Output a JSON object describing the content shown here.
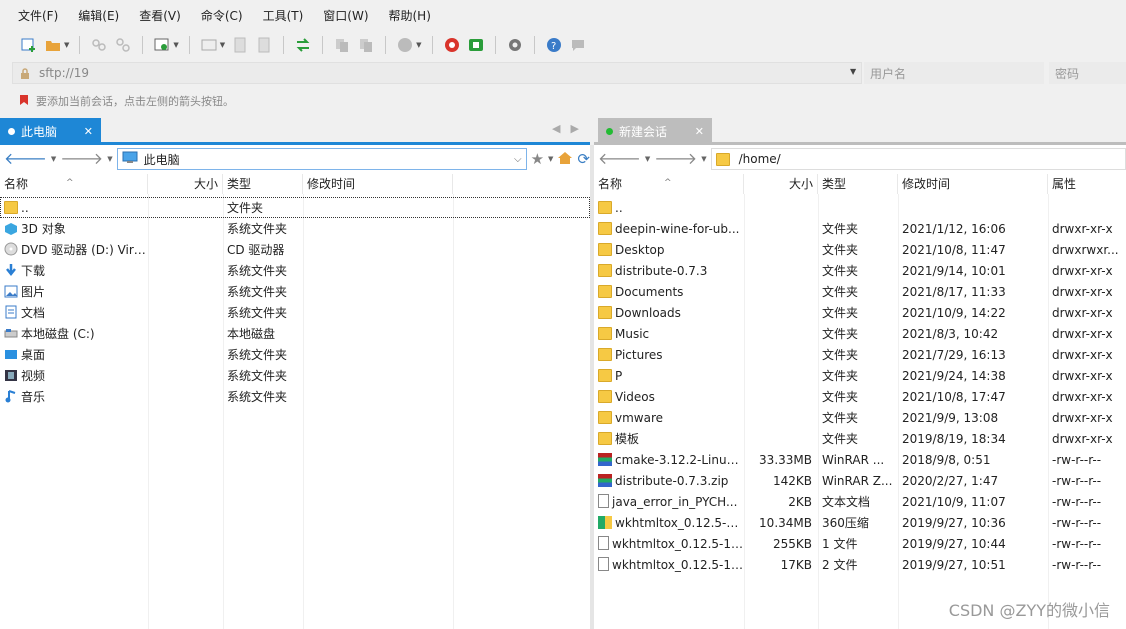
{
  "menu": [
    "文件(F)",
    "编辑(E)",
    "查看(V)",
    "命令(C)",
    "工具(T)",
    "窗口(W)",
    "帮助(H)"
  ],
  "address": {
    "host": "sftp://19",
    "user_placeholder": "用户名",
    "pass_placeholder": "密码"
  },
  "hint": "要添加当前会话，点击左侧的箭头按钮。",
  "left": {
    "tab_label": "此电脑",
    "path": "此电脑",
    "headers": {
      "name": "名称",
      "size": "大小",
      "type": "类型",
      "mtime": "修改时间"
    },
    "rows": [
      {
        "name": "..",
        "type": "文件夹",
        "icon": "folder-icon"
      },
      {
        "name": "3D 对象",
        "type": "系统文件夹",
        "icon": "3d-objects-icon"
      },
      {
        "name": "DVD 驱动器 (D:) Virt...",
        "type": "CD 驱动器",
        "icon": "dvd-drive-icon"
      },
      {
        "name": "下载",
        "type": "系统文件夹",
        "icon": "download-icon"
      },
      {
        "name": "图片",
        "type": "系统文件夹",
        "icon": "pictures-icon"
      },
      {
        "name": "文档",
        "type": "系统文件夹",
        "icon": "documents-icon"
      },
      {
        "name": "本地磁盘 (C:)",
        "type": "本地磁盘",
        "icon": "local-disk-icon"
      },
      {
        "name": "桌面",
        "type": "系统文件夹",
        "icon": "desktop-icon"
      },
      {
        "name": "视频",
        "type": "系统文件夹",
        "icon": "videos-icon"
      },
      {
        "name": "音乐",
        "type": "系统文件夹",
        "icon": "music-icon"
      }
    ]
  },
  "right": {
    "tab_label": "新建会话",
    "path": "/home/",
    "headers": {
      "name": "名称",
      "size": "大小",
      "type": "类型",
      "mtime": "修改时间",
      "attr": "属性"
    },
    "rows": [
      {
        "name": "..",
        "size": "",
        "type": "",
        "mtime": "",
        "attr": "",
        "icon": "folder-icon"
      },
      {
        "name": "deepin-wine-for-ub...",
        "size": "",
        "type": "文件夹",
        "mtime": "2021/1/12, 16:06",
        "attr": "drwxr-xr-x",
        "icon": "folder-icon"
      },
      {
        "name": "Desktop",
        "size": "",
        "type": "文件夹",
        "mtime": "2021/10/8, 11:47",
        "attr": "drwxrwxr...",
        "icon": "folder-icon"
      },
      {
        "name": "distribute-0.7.3",
        "size": "",
        "type": "文件夹",
        "mtime": "2021/9/14, 10:01",
        "attr": "drwxr-xr-x",
        "icon": "folder-icon"
      },
      {
        "name": "Documents",
        "size": "",
        "type": "文件夹",
        "mtime": "2021/8/17, 11:33",
        "attr": "drwxr-xr-x",
        "icon": "folder-icon"
      },
      {
        "name": "Downloads",
        "size": "",
        "type": "文件夹",
        "mtime": "2021/10/9, 14:22",
        "attr": "drwxr-xr-x",
        "icon": "folder-icon"
      },
      {
        "name": "Music",
        "size": "",
        "type": "文件夹",
        "mtime": "2021/8/3, 10:42",
        "attr": "drwxr-xr-x",
        "icon": "folder-icon"
      },
      {
        "name": "Pictures",
        "size": "",
        "type": "文件夹",
        "mtime": "2021/7/29, 16:13",
        "attr": "drwxr-xr-x",
        "icon": "folder-icon"
      },
      {
        "name": "P",
        "size": "",
        "type": "文件夹",
        "mtime": "2021/9/24, 14:38",
        "attr": "drwxr-xr-x",
        "icon": "folder-icon"
      },
      {
        "name": "Videos",
        "size": "",
        "type": "文件夹",
        "mtime": "2021/10/8, 17:47",
        "attr": "drwxr-xr-x",
        "icon": "folder-icon"
      },
      {
        "name": "vmware",
        "size": "",
        "type": "文件夹",
        "mtime": "2021/9/9, 13:08",
        "attr": "drwxr-xr-x",
        "icon": "folder-icon"
      },
      {
        "name": "模板",
        "size": "",
        "type": "文件夹",
        "mtime": "2019/8/19, 18:34",
        "attr": "drwxr-xr-x",
        "icon": "folder-icon"
      },
      {
        "name": "cmake-3.12.2-Linux...",
        "size": "33.33MB",
        "type": "WinRAR ...",
        "mtime": "2018/9/8, 0:51",
        "attr": "-rw-r--r--",
        "icon": "winrar-icon"
      },
      {
        "name": "distribute-0.7.3.zip",
        "size": "142KB",
        "type": "WinRAR Z...",
        "mtime": "2020/2/27, 1:47",
        "attr": "-rw-r--r--",
        "icon": "winrar-icon"
      },
      {
        "name": "java_error_in_PYCH...",
        "size": "2KB",
        "type": "文本文档",
        "mtime": "2021/10/9, 11:07",
        "attr": "-rw-r--r--",
        "icon": "text-file-icon"
      },
      {
        "name": "wkhtmltox_0.12.5-1....",
        "size": "10.34MB",
        "type": "360压缩",
        "mtime": "2019/9/27, 10:36",
        "attr": "-rw-r--r--",
        "icon": "archive-360-icon"
      },
      {
        "name": "wkhtmltox_0.12.5-1....",
        "size": "255KB",
        "type": "1 文件",
        "mtime": "2019/9/27, 10:44",
        "attr": "-rw-r--r--",
        "icon": "file-icon"
      },
      {
        "name": "wkhtmltox_0.12.5-1....",
        "size": "17KB",
        "type": "2 文件",
        "mtime": "2019/9/27, 10:51",
        "attr": "-rw-r--r--",
        "icon": "file-icon"
      }
    ]
  },
  "watermark": "CSDN @ZYY的微小信",
  "colors": {
    "accent": "#1e87d6",
    "tab_inactive": "#bdbdbd",
    "folder": "#f6c944",
    "session_dot": "#22bb33"
  }
}
